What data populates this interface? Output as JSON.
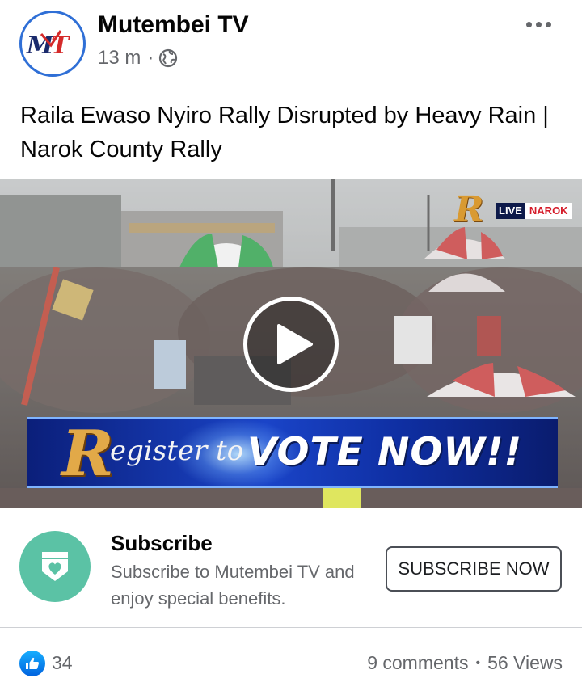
{
  "post": {
    "page_name": "Mutembei TV",
    "avatar_text": "MT",
    "time": "13 m",
    "meta_dot": "·",
    "privacy_icon": "globe-icon",
    "more_icon": "more-options-icon",
    "text": "Raila  Ewaso Nyiro Rally Disrupted by Heavy Rain | Narok County Rally"
  },
  "video": {
    "channel_logo": "R",
    "live_label": "LIVE",
    "location_label": "NAROK",
    "banner_letter": "R",
    "banner_script": "egister to",
    "banner_main": "VOTE NOW!!",
    "play_icon": "play-icon"
  },
  "subscribe": {
    "title": "Subscribe",
    "description": "Subscribe to Mutembei TV and enjoy special benefits.",
    "button_label": "SUBSCRIBE NOW",
    "icon": "shield-heart-icon",
    "icon_color": "#5bc2a5"
  },
  "footer": {
    "like_count": "34",
    "comments": "9 comments",
    "separator": "•",
    "views": "56 Views",
    "like_color": "#1877f2"
  }
}
